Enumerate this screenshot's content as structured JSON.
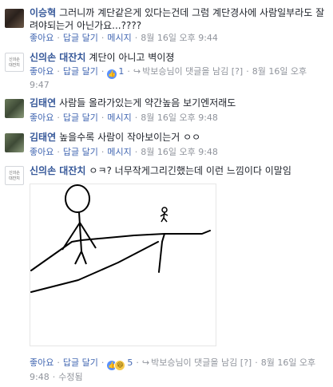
{
  "comments": [
    {
      "author": "이승혁",
      "body": "그러니까 계단같은게 있다는건데 그럼 계단경사에 사람일부라도 잘려야되는거 아닌가요...????",
      "actions": {
        "like": "좋아요",
        "reply": "답글 달기",
        "message": "메시지",
        "time": "8월 16일 오후 9:44"
      }
    },
    {
      "author": "신의손 대잔치",
      "avatar_text": [
        "신의손",
        "대잔치"
      ],
      "body": "계단이 아니고 벽이졍",
      "actions": {
        "like": "좋아요",
        "reply": "답글 달기",
        "reaction_count": "1",
        "reply_note": "박보승님이 댓글을 남김",
        "flag": "[?]",
        "time": "8월 16일 오후 9:47"
      }
    },
    {
      "author": "김태연",
      "body": "사람들 올라가있는게 약간높음 보기엔저래도",
      "actions": {
        "like": "좋아요",
        "reply": "답글 달기",
        "message": "메시지",
        "time": "8월 16일 오후 9:48"
      }
    },
    {
      "author": "김태연",
      "body": "높을수록 사람이 작아보이는거 ㅇㅇ",
      "actions": {
        "like": "좋아요",
        "reply": "답글 달기",
        "message": "메시지",
        "time": "8월 16일 오후 9:48"
      }
    },
    {
      "author": "신의손 대잔치",
      "avatar_text": [
        "신의손",
        "대잔치"
      ],
      "body": "ㅇㅋ? 너무작게그리긴했는데 이런 느낌이다 이말임",
      "actions": {
        "like": "좋아요",
        "reply": "답글 달기",
        "reaction_count": "5",
        "reply_note": "박보승님이 댓글을 남김",
        "flag": "[?]",
        "time": "8월 16일 오후 9:48",
        "edited": "수정됨"
      }
    }
  ],
  "colors": {
    "link": "#4267b2",
    "name": "#365899",
    "meta": "#90949c",
    "like": "#5890ff",
    "haha": "#f7c94b"
  }
}
